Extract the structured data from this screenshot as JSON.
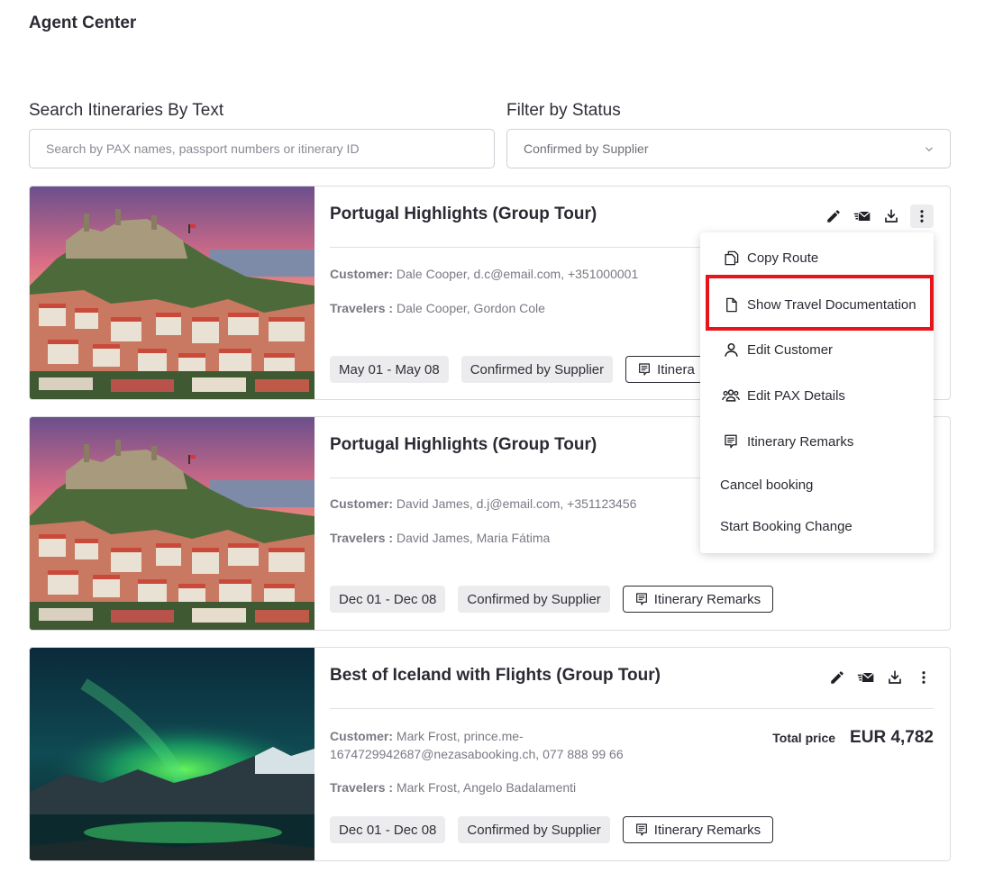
{
  "app": {
    "title": "Agent Center"
  },
  "search": {
    "label": "Search Itineraries By Text",
    "placeholder": "Search by PAX names, passport numbers or itinerary ID"
  },
  "filter": {
    "label": "Filter by Status",
    "selected": "Confirmed by Supplier"
  },
  "cards": [
    {
      "title": "Portugal Highlights (Group Tour)",
      "customer_label": "Customer:",
      "customer": "Dale Cooper, d.c@email.com, +351000001",
      "travelers_label": "Travelers :",
      "travelers": "Dale Cooper, Gordon Cole",
      "dates": "May 01 - May 08",
      "status": "Confirmed by Supplier",
      "remarks_label": "Itinera"
    },
    {
      "title": "Portugal Highlights (Group Tour)",
      "customer_label": "Customer:",
      "customer": "David James, d.j@email.com, +351123456",
      "travelers_label": "Travelers :",
      "travelers": "David James, Maria Fátima",
      "dates": "Dec 01 - Dec 08",
      "status": "Confirmed by Supplier",
      "remarks_label": "Itinerary Remarks"
    },
    {
      "title": "Best of Iceland with Flights (Group Tour)",
      "customer_label": "Customer:",
      "customer": "Mark Frost, prince.me-1674729942687@nezasabooking.ch, 077 888 99 66",
      "travelers_label": "Travelers :",
      "travelers": "Mark Frost, Angelo Badalamenti",
      "dates": "Dec 01 - Dec 08",
      "status": "Confirmed by Supplier",
      "remarks_label": "Itinerary Remarks",
      "total_price_label": "Total price",
      "total_price": "EUR 4,782"
    }
  ],
  "menu": {
    "items": [
      {
        "label": "Copy Route",
        "icon": "copy-icon"
      },
      {
        "label": "Show Travel Documentation",
        "icon": "document-icon"
      },
      {
        "label": "Edit Customer",
        "icon": "person-icon"
      },
      {
        "label": "Edit PAX Details",
        "icon": "group-icon"
      },
      {
        "label": "Itinerary Remarks",
        "icon": "remarks-icon"
      },
      {
        "label": "Cancel booking"
      },
      {
        "label": "Start Booking Change"
      }
    ]
  },
  "colors": {
    "highlight": "#e8141c",
    "text": "#2a2a33",
    "chip_bg": "#ececee"
  }
}
